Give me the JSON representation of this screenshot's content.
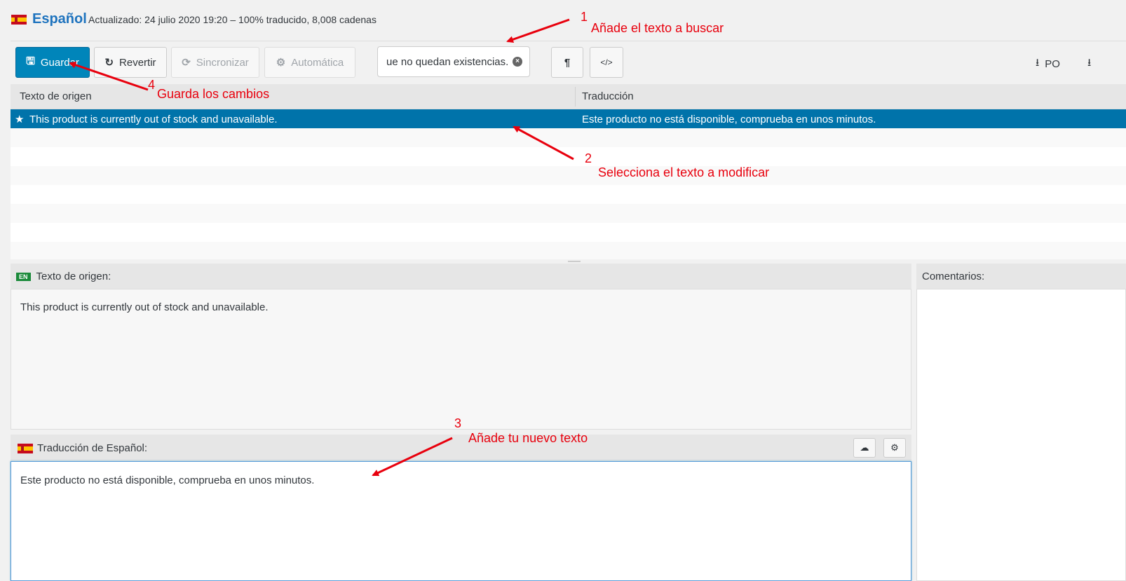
{
  "header": {
    "flag_icon": "spain-flag-icon",
    "language": "Español",
    "meta": "Actualizado: 24 julio 2020 19:20 – 100% traducido, 8,008 cadenas"
  },
  "toolbar": {
    "save_label": "Guardar",
    "revert_label": "Revertir",
    "sync_label": "Sincronizar",
    "auto_label": "Automática",
    "search_value": "ue no quedan existencias.",
    "pilcrow_glyph": "¶",
    "code_glyph": "</>",
    "download_po": "PO"
  },
  "grid": {
    "source_header": "Texto de origen",
    "translation_header": "Traducción",
    "selected_row": {
      "source": "This product is currently out of stock and unavailable.",
      "translation": "Este producto no está disponible, comprueba en unos minutos."
    }
  },
  "source_pane": {
    "tag": "EN",
    "title": "Texto de origen:",
    "text": "This product is currently out of stock and unavailable."
  },
  "comments_pane": {
    "title": "Comentarios:"
  },
  "translation_pane": {
    "title": "Traducción de Español:",
    "text": "Este producto no está disponible, comprueba en unos minutos."
  },
  "annotations": {
    "a1_num": "1",
    "a1_text": "Añade el texto a buscar",
    "a2_num": "2",
    "a2_text": "Selecciona el texto a modificar",
    "a3_num": "3",
    "a3_text": "Añade tu nuevo texto",
    "a4_num": "4",
    "a4_text": "Guarda los cambios",
    "color": "#e8000d"
  },
  "colors": {
    "accent": "#0085ba",
    "selected_row": "#0073aa",
    "title_blue": "#1e73be"
  }
}
